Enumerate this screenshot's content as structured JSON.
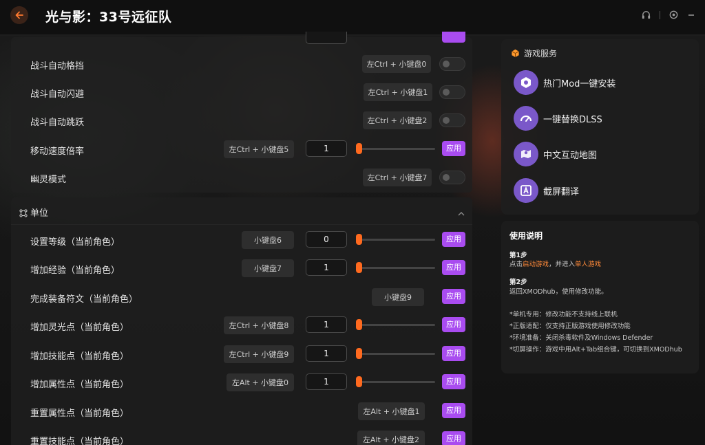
{
  "app": {
    "title": "光与影：33号远征队"
  },
  "panel_top": {
    "rows": [
      {
        "label": "战斗自动格挡",
        "hotkey": "左Ctrl + 小键盘0"
      },
      {
        "label": "战斗自动闪避",
        "hotkey": "左Ctrl + 小键盘1"
      },
      {
        "label": "战斗自动跳跃",
        "hotkey": "左Ctrl + 小键盘2"
      },
      {
        "label": "移动速度倍率",
        "hotkey": "左Ctrl + 小键盘5",
        "value": "1",
        "apply": "应用"
      },
      {
        "label": "幽灵模式",
        "hotkey": "左Ctrl + 小键盘7"
      }
    ],
    "top_apply": "应用"
  },
  "unit_section": {
    "title": "单位",
    "rows": [
      {
        "label": "设置等级（当前角色）",
        "hotkey": "小键盘6",
        "value": "0",
        "apply": "应用"
      },
      {
        "label": "增加经验（当前角色）",
        "hotkey": "小键盘7",
        "value": "1",
        "apply": "应用"
      },
      {
        "label": "完成装备符文（当前角色）",
        "hotkey": "小键盘9",
        "apply": "应用"
      },
      {
        "label": "增加灵光点（当前角色）",
        "hotkey": "左Ctrl + 小键盘8",
        "value": "1",
        "apply": "应用"
      },
      {
        "label": "增加技能点（当前角色）",
        "hotkey": "左Ctrl + 小键盘9",
        "value": "1",
        "apply": "应用"
      },
      {
        "label": "增加属性点（当前角色）",
        "hotkey": "左Alt + 小键盘0",
        "value": "1",
        "apply": "应用"
      },
      {
        "label": "重置属性点（当前角色）",
        "hotkey": "左Alt + 小键盘1",
        "apply": "应用"
      },
      {
        "label": "重置技能点（当前角色）",
        "hotkey": "左Alt + 小键盘2",
        "apply": "应用"
      }
    ]
  },
  "services": {
    "title": "游戏服务",
    "items": [
      {
        "label": "热门Mod一键安装"
      },
      {
        "label": "一键替换DLSS"
      },
      {
        "label": "中文互动地图"
      },
      {
        "label": "截屏翻译"
      }
    ]
  },
  "guide": {
    "title": "使用说明",
    "step1_title": "第1步",
    "step1_pre": "点击",
    "step1_link1": "启动游戏",
    "step1_mid": "，并进入",
    "step1_link2": "单人游戏",
    "step2_title": "第2步",
    "step2_text": "返回XMODhub，使用修改功能。",
    "notes": [
      "*单机专用：修改功能不支持线上联机",
      "*正版适配：仅支持正版游戏使用修改功能",
      "*环境准备：关闭杀毒软件及Windows Defender",
      "*切屏操作：游戏中用Alt+Tab组合键，可切换到XMODhub"
    ]
  },
  "colors": {
    "accent": "#ff6a1f",
    "apply": "#a94cf0",
    "service_icon": "#7a58c9"
  }
}
